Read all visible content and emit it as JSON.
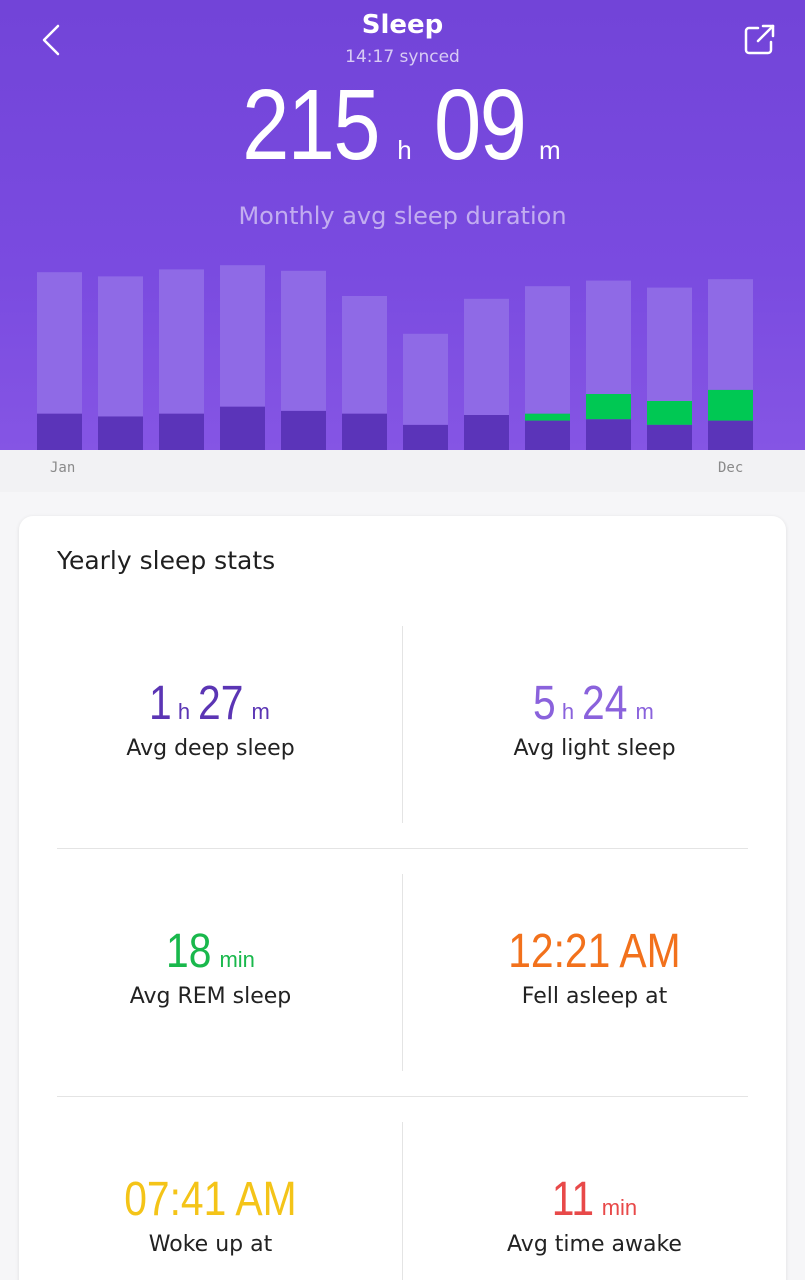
{
  "header": {
    "title": "Sleep",
    "synced": "14:17 synced",
    "hours": "215",
    "hours_unit": "h",
    "minutes": "09",
    "minutes_unit": "m",
    "subtitle": "Monthly avg sleep duration"
  },
  "chart_data": {
    "type": "bar",
    "x_start_label": "Jan",
    "x_end_label": "Dec",
    "series": [
      {
        "values": [
          2.6,
          2.4,
          2.6,
          3.1,
          2.8,
          2.6,
          1.8,
          2.5,
          2.1,
          2.2,
          1.8,
          2.1
        ]
      },
      {
        "values": [
          0,
          0,
          0,
          0,
          0,
          0,
          0,
          0,
          0.5,
          1.8,
          1.7,
          2.2
        ]
      },
      {
        "values": [
          10.1,
          10.0,
          10.3,
          10.1,
          10.0,
          8.4,
          6.5,
          8.3,
          9.1,
          8.1,
          8.1,
          7.9
        ]
      }
    ],
    "colors": [
      "#5b34b9",
      "#00c853",
      "#8f6ae6"
    ],
    "ylim": [
      0,
      15
    ]
  },
  "stats": {
    "title": "Yearly sleep stats",
    "deep": {
      "h": "1",
      "h_unit": "h",
      "m": "27",
      "m_unit": "m",
      "label": "Avg deep sleep",
      "color": "#5b35b4"
    },
    "light": {
      "h": "5",
      "h_unit": "h",
      "m": "24",
      "m_unit": "m",
      "label": "Avg light sleep",
      "color": "#8a62dc"
    },
    "rem": {
      "value": "18",
      "unit": "min",
      "label": "Avg REM sleep",
      "color": "#19b84c"
    },
    "fell_asleep": {
      "value": "12:21 AM",
      "label": "Fell asleep at",
      "color": "#f2711c"
    },
    "woke_up": {
      "value": "07:41 AM",
      "label": "Woke up at",
      "color": "#f4c418"
    },
    "awake": {
      "value": "11",
      "unit": "min",
      "label": "Avg time awake",
      "color": "#e84949"
    }
  }
}
